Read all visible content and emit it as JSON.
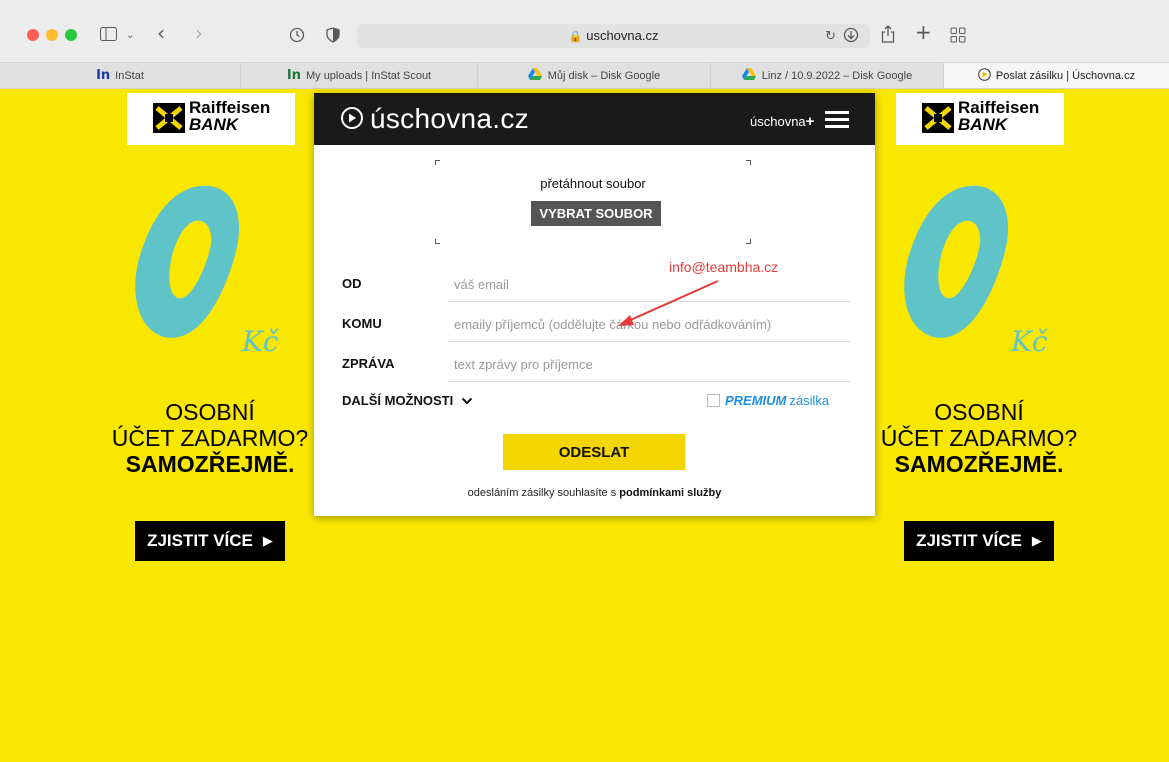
{
  "browser": {
    "url": "uschovna.cz",
    "tabs": [
      {
        "label": "InStat",
        "favicon": "instat-icon"
      },
      {
        "label": "My uploads | InStat Scout",
        "favicon": "instat-icon"
      },
      {
        "label": "Můj disk – Disk Google",
        "favicon": "google-drive-icon"
      },
      {
        "label": "Linz / 10.9.2022 – Disk Google",
        "favicon": "google-drive-icon"
      },
      {
        "label": "Poslat zásilku | Úschovna.cz",
        "favicon": "uschovna-icon"
      }
    ]
  },
  "ad": {
    "bank_line1": "Raiffeisen",
    "bank_line2": "BANK",
    "kc": "Kč",
    "line1": "OSOBNÍ",
    "line2": "ÚČET ZADARMO?",
    "line3": "SAMOZŘEJMĚ.",
    "cta": "ZJISTIT VÍCE"
  },
  "site": {
    "logo": "úschovna.cz",
    "plus_label": "úschovna",
    "plus_sign": "+"
  },
  "upload": {
    "drop_label": "přetáhnout soubor",
    "pick_button": "VYBRAT SOUBOR"
  },
  "form": {
    "from_label": "OD",
    "from_placeholder": "váš email",
    "to_label": "KOMU",
    "to_placeholder": "emaily příjemců (oddělujte čárkou nebo odřádkováním)",
    "message_label": "ZPRÁVA",
    "message_placeholder": "text zprávy pro příjemce",
    "more_options": "DALŠÍ MOŽNOSTI",
    "premium_bold": "PREMIUM",
    "premium_rest": "zásilka",
    "premium_checked": false,
    "send_button": "ODESLAT",
    "terms_prefix": "odesláním zásilky souhlasíte s ",
    "terms_link": "podmínkami služby"
  },
  "annotation": {
    "text": "info@teambha.cz",
    "color": "#e43a3a"
  },
  "colors": {
    "ad_background": "#fae700",
    "ad_teal": "#5ec4c8",
    "header_dark": "#1a1a1a",
    "send_button": "#f3d500",
    "premium_blue": "#1d8fe0"
  }
}
